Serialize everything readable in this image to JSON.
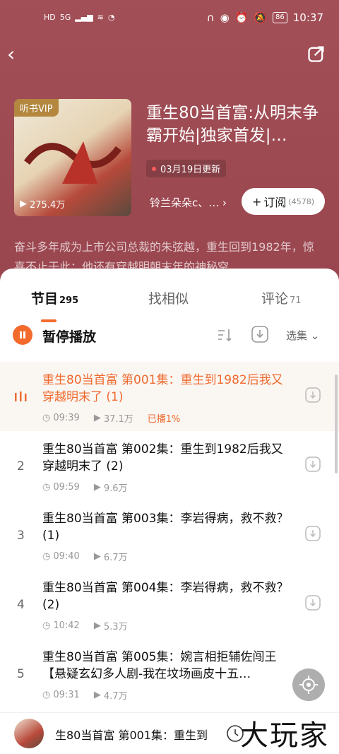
{
  "status_bar": {
    "left_icons": [
      "HD",
      "5G",
      "signal-icon",
      "wifi-icon",
      "nfc-icon"
    ],
    "battery": "86",
    "time": "10:37"
  },
  "album": {
    "vip_badge": "听书VIP",
    "plays": "275.4万",
    "title": "重生80当首富:从明末争霸开始|独家首发|…",
    "updated": "03月19日更新",
    "author": "铃兰朵朵c、…",
    "subscribe_label": "订阅",
    "subscribe_count": "(4578)",
    "description": "奋斗多年成为上市公司总裁的朱弦越，重生回到1982年，惊喜不止于此：他还有穿越明朝末年的神秘空"
  },
  "tabs": [
    {
      "label": "节目",
      "count": "295"
    },
    {
      "label": "找相似",
      "count": ""
    },
    {
      "label": "评论",
      "count": "71"
    }
  ],
  "controls": {
    "pause_label": "暂停播放",
    "choose_label": "选集"
  },
  "episodes": [
    {
      "index": "",
      "title": "重生80当首富 第001集：重生到1982后我又穿越明末了 (1)",
      "duration": "09:39",
      "plays": "37.1万",
      "progress": "已播1%"
    },
    {
      "index": "2",
      "title": "重生80当首富 第002集：重生到1982后我又穿越明末了 (2)",
      "duration": "09:59",
      "plays": "9.6万",
      "progress": ""
    },
    {
      "index": "3",
      "title": "重生80当首富 第003集：李岩得病，救不救？ (1)",
      "duration": "09:40",
      "plays": "6.7万",
      "progress": ""
    },
    {
      "index": "4",
      "title": "重生80当首富 第004集：李岩得病，救不救？ (2)",
      "duration": "10:42",
      "plays": "5.3万",
      "progress": ""
    },
    {
      "index": "5",
      "title": "重生80当首富 第005集：婉言相拒辅佐闯王【悬疑玄幻多人剧-我在坟场画皮十五…",
      "duration": "09:31",
      "plays": "4.7万",
      "progress": ""
    }
  ],
  "mini_player": {
    "text": "生80当首富 第001集：重生到"
  },
  "watermark": "大玩家",
  "colors": {
    "accent": "#f26b2d",
    "hero_bg": "#9d4a52"
  }
}
